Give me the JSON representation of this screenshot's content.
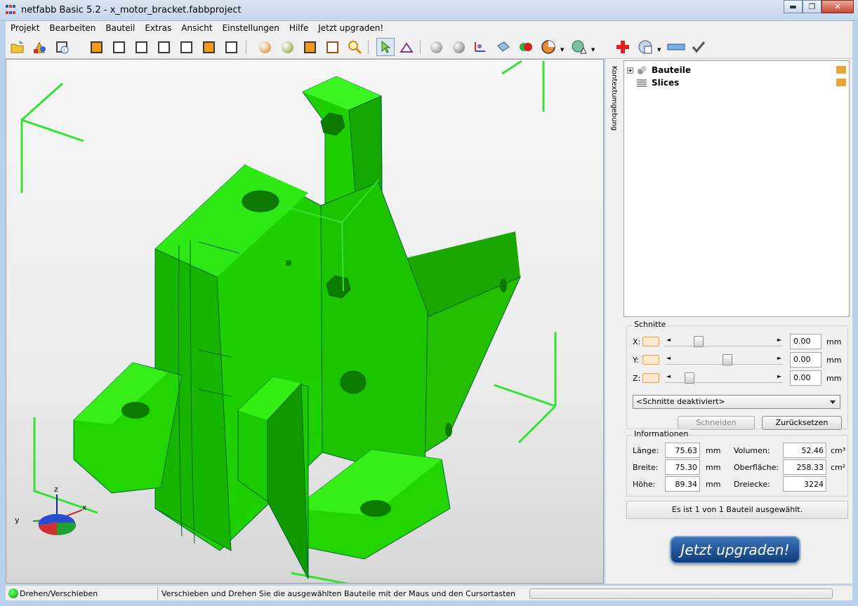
{
  "window": {
    "title": "netfabb Basic 5.2 - x_motor_bracket.fabbproject",
    "minimize": "▬",
    "maximize": "❐",
    "close": "✕"
  },
  "menu": [
    "Projekt",
    "Bearbeiten",
    "Bauteil",
    "Extras",
    "Ansicht",
    "Einstellungen",
    "Hilfe",
    "Jetzt upgraden!"
  ],
  "toolbar": {
    "buttons": [
      "open-project-icon",
      "add-part-icon",
      "part-info-icon",
      "view-front-icon",
      "view-back-icon",
      "view-left-icon",
      "view-right-icon",
      "view-top-icon",
      "view-bottom-icon",
      "view-perspective-icon",
      "shading-icon",
      "texture-icon",
      "box-view-icon",
      "wireframe-icon",
      "zoom-icon",
      "select-tool-icon",
      "measure-tool-icon",
      "sphere-icon",
      "move-icon",
      "axes-icon",
      "section-icon",
      "colors-icon",
      "pie-view-icon",
      "warning-view-icon",
      "repair-icon",
      "analysis-icon",
      "ruler-icon",
      "apply-icon"
    ]
  },
  "sidebar": {
    "tab_label": "Kontextumgebung"
  },
  "tree": {
    "items": [
      {
        "label": "Bauteile"
      },
      {
        "label": "Slices"
      }
    ]
  },
  "axes_gizmo": {
    "x": "x",
    "y": "y",
    "z": "z"
  },
  "schnitte": {
    "title": "Schnitte",
    "rows": [
      {
        "axis": "X:",
        "value": "0.00",
        "unit": "mm",
        "level": 0.2
      },
      {
        "axis": "Y:",
        "value": "0.00",
        "unit": "mm",
        "level": 0.5
      },
      {
        "axis": "Z:",
        "value": "0.00",
        "unit": "mm",
        "level": 0.1
      }
    ],
    "mode": "<Schnitte deaktiviert>",
    "cut_button": "Schneiden",
    "reset_button": "Zurücksetzen"
  },
  "informationen": {
    "title": "Informationen",
    "laenge": {
      "label": "Länge:",
      "value": "75.63",
      "unit": "mm"
    },
    "breite": {
      "label": "Breite:",
      "value": "75.30",
      "unit": "mm"
    },
    "hoehe": {
      "label": "Höhe:",
      "value": "89.34",
      "unit": "mm"
    },
    "volumen": {
      "label": "Volumen:",
      "value": "52.46",
      "unit": "cm³"
    },
    "oberflaeche": {
      "label": "Oberfläche:",
      "value": "258.33",
      "unit": "cm²"
    },
    "dreiecke": {
      "label": "Dreiecke:",
      "value": "3224"
    }
  },
  "selection_info": "Es ist 1 von 1 Bauteil ausgewählt.",
  "upgrade_button": "Jetzt upgraden!",
  "status": {
    "mode": "Drehen/Verschieben",
    "message": "Verschieben und Drehen Sie die ausgewählten Bauteile mit der Maus und den Cursortasten"
  },
  "colors": {
    "part": "#1ecb00",
    "bbox": "#33e233",
    "accent": "#0d3d7c"
  }
}
